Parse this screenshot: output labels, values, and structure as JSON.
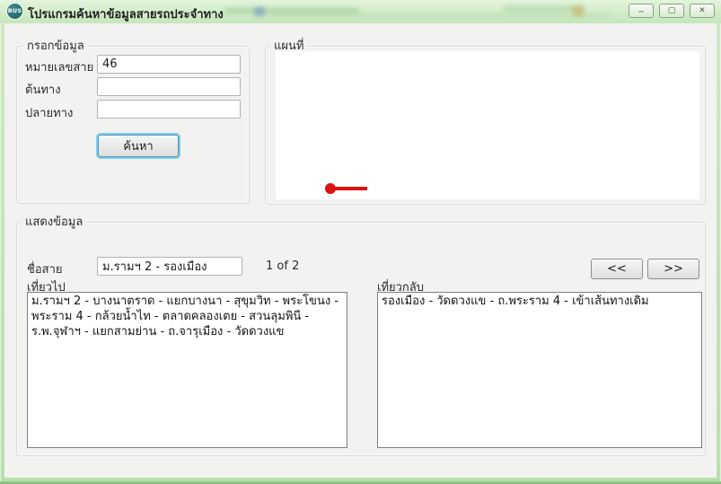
{
  "window": {
    "title": "โปรแกรมค้นหาข้อมูลสายรถประจำทาง",
    "icon_label": "BUS",
    "controls": {
      "minimize_glyph": "─",
      "maximize_glyph": "▢",
      "close_glyph": "✕"
    }
  },
  "input_group": {
    "title": "กรอกข้อมูล",
    "fields": [
      {
        "label": "หมายเลขสาย",
        "value": "46"
      },
      {
        "label": "ต้นทาง",
        "value": ""
      },
      {
        "label": "ปลายทาง",
        "value": ""
      }
    ],
    "search_button_label": "ค้นหา"
  },
  "map_group": {
    "title": "แผนที่",
    "marker_color": "#dd1111"
  },
  "result_group": {
    "title": "แสดงข้อมูล",
    "route_name_label": "ชื่อสาย",
    "route_name_value": "ม.รามฯ 2 - รองเมือง",
    "pager_text": "1 of 2",
    "prev_button_label": "<<",
    "next_button_label": ">>",
    "outbound_label": "เที่ยวไป",
    "outbound_text": "ม.รามฯ 2 - บางนาตราด - แยกบางนา - สุขุมวิท - พระโขนง - พระราม 4 - กล้วยน้ำไท - ตลาดคลองเตย - สวนลุมพินี - ร.พ.จุฬาฯ - แยกสามย่าน - ถ.จารุเมือง - วัดดวงแข",
    "return_label": "เที่ยวกลับ",
    "return_text": "รองเมือง - วัดดวงแข - ถ.พระราม 4 - เข้าเส้นทางเดิม"
  },
  "colors": {
    "titlebar_green": "#d5ecca",
    "frame_green": "#b9dfae",
    "client_bg": "#f2f2f0",
    "marker_red": "#dd1111",
    "focus_ring_blue": "#7ecdea"
  }
}
